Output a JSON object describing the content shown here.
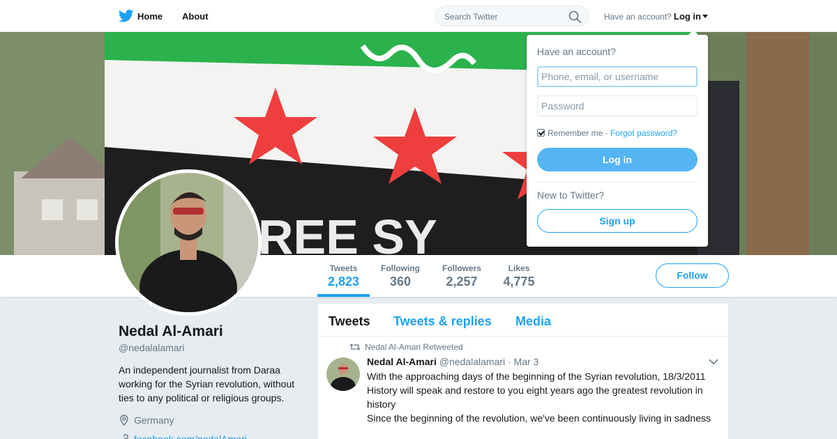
{
  "nav": {
    "home_label": "Home",
    "about_label": "About",
    "search_placeholder": "Search Twitter",
    "have_account": "Have an account?",
    "login_label": "Log in"
  },
  "colors": {
    "accent": "#1da1f2",
    "text": "#14171a",
    "muted": "#657786",
    "page_bg": "#e6ecf0"
  },
  "stats": [
    {
      "label": "Tweets",
      "value": "2,823"
    },
    {
      "label": "Following",
      "value": "360"
    },
    {
      "label": "Followers",
      "value": "2,257"
    },
    {
      "label": "Likes",
      "value": "4,775"
    }
  ],
  "follow_label": "Follow",
  "profile": {
    "name": "Nedal Al-Amari",
    "handle": "@nedalalamari",
    "bio": "An independent journalist from Daraa working for the Syrian revolution, without ties to any political or religious groups.",
    "location": "Germany",
    "link": "facebook.com/nedalAmari"
  },
  "timeline": {
    "tabs": [
      "Tweets",
      "Tweets & replies",
      "Media"
    ],
    "tweet": {
      "retweet_line": "Nedal Al-Amari Retweeted",
      "name": "Nedal Al-Amari",
      "handle": "@nedalalamari",
      "date": "· Mar 3",
      "lines": [
        "With the approaching days of the beginning of the Syrian revolution, 18/3/2011",
        "History will speak and restore to you eight years ago the greatest revolution in history",
        "Since the beginning of the revolution, we've been continuously living in sadness"
      ]
    }
  },
  "login_dropdown": {
    "title": "Have an account?",
    "username_placeholder": "Phone, email, or username",
    "password_placeholder": "Password",
    "remember": "Remember me",
    "separator": "·",
    "forgot": "Forgot password?",
    "login_button": "Log in",
    "new_to": "New to Twitter?",
    "signup_button": "Sign up"
  },
  "icons": {
    "logo": "twitter-bird-icon",
    "search": "search-icon",
    "location": "location-pin-icon",
    "link": "link-icon",
    "retweet": "retweet-icon",
    "chevron": "chevron-down-icon"
  }
}
